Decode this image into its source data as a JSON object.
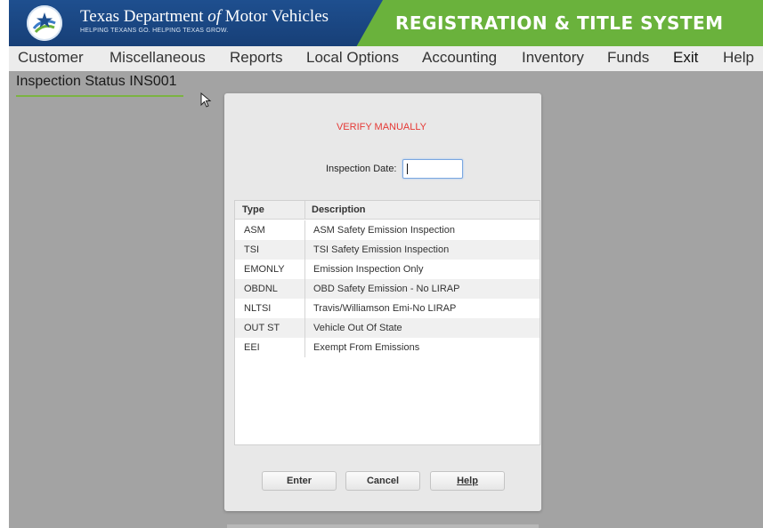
{
  "header": {
    "agency_name_prefix": "Texas Department",
    "agency_name_of": "of",
    "agency_name_suffix": "Motor Vehicles",
    "tagline": "HELPING TEXANS GO. HELPING TEXAS GROW.",
    "system_title": "REGISTRATION & TITLE SYSTEM",
    "logo_icon": "texas-star-logo"
  },
  "menu": [
    "Customer",
    "Miscellaneous",
    "Reports",
    "Local Options",
    "Accounting",
    "Inventory",
    "Funds",
    "Exit",
    "Help"
  ],
  "page": {
    "title": "Inspection Status INS001"
  },
  "dialog": {
    "title": "VERIFY MANUALLY",
    "date_label": "Inspection Date:",
    "date_value": "",
    "table": {
      "headers": [
        "Type",
        "Description"
      ],
      "rows": [
        {
          "type": "ASM",
          "description": "ASM Safety Emission Inspection"
        },
        {
          "type": "TSI",
          "description": "TSI Safety Emission Inspection"
        },
        {
          "type": "EMONLY",
          "description": "Emission Inspection Only"
        },
        {
          "type": "OBDNL",
          "description": "OBD Safety Emission - No LIRAP"
        },
        {
          "type": "NLTSI",
          "description": "Travis/Williamson Emi-No LIRAP"
        },
        {
          "type": "OUT ST",
          "description": "Vehicle Out Of State"
        },
        {
          "type": "EEI",
          "description": "Exempt From Emissions"
        }
      ]
    },
    "buttons": {
      "enter": "Enter",
      "cancel": "Cancel",
      "help": "Help"
    }
  },
  "colors": {
    "banner_blue": "#1e4f8f",
    "banner_green": "#6ab23c",
    "dialog_title": "#e53935",
    "backdrop": "#a3a3a3"
  }
}
